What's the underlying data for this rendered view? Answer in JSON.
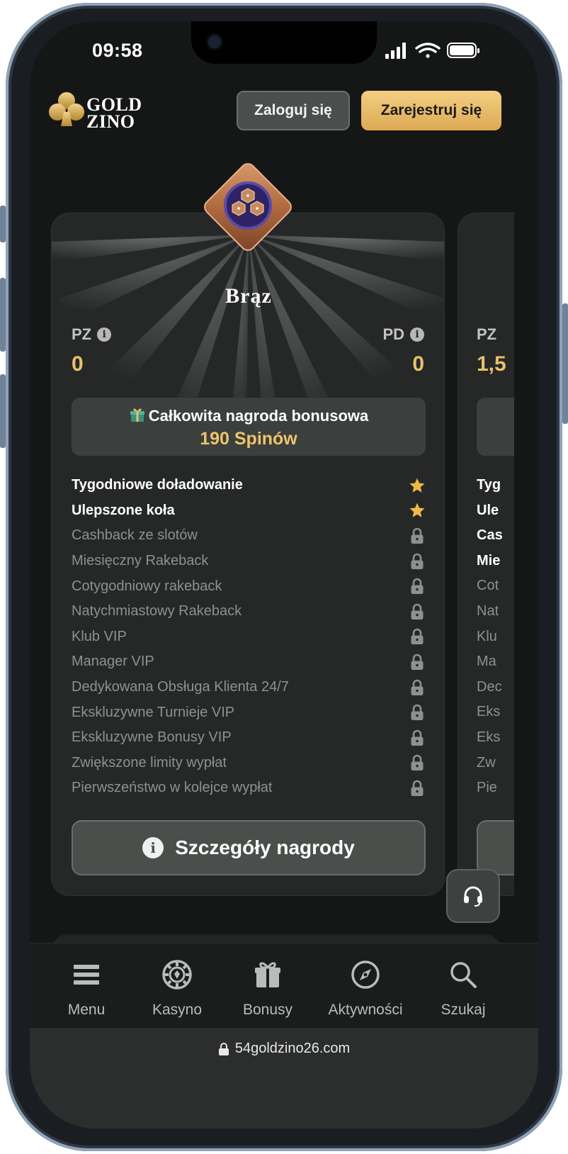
{
  "status_bar": {
    "time": "09:58"
  },
  "header": {
    "logo_line1": "GOLD",
    "logo_line2": "ZINO",
    "login_label": "Zaloguj się",
    "register_label": "Zarejestruj się"
  },
  "colors": {
    "accent_gold": "#e9c06a",
    "card_bg": "#252826",
    "page_bg": "#151716"
  },
  "tier_card": {
    "icon": "bronze-diamond-badge-icon",
    "name": "Brąz",
    "left_stat": {
      "label": "PZ",
      "value": "0"
    },
    "right_stat": {
      "label": "PD",
      "value": "0"
    },
    "bonus_title": "Całkowita nagroda bonusowa",
    "bonus_value": "190 Spinów",
    "perks": [
      {
        "label": "Tygodniowe doładowanie",
        "status": "star"
      },
      {
        "label": "Ulepszone koła",
        "status": "star"
      },
      {
        "label": "Cashback ze slotów",
        "status": "locked"
      },
      {
        "label": "Miesięczny Rakeback",
        "status": "locked"
      },
      {
        "label": "Cotygodniowy rakeback",
        "status": "locked"
      },
      {
        "label": "Natychmiastowy Rakeback",
        "status": "locked"
      },
      {
        "label": "Klub VIP",
        "status": "locked"
      },
      {
        "label": "Manager VIP",
        "status": "locked"
      },
      {
        "label": "Dedykowana Obsługa Klienta 24/7",
        "status": "locked"
      },
      {
        "label": "Ekskluzywne Turnieje VIP",
        "status": "locked"
      },
      {
        "label": "Ekskluzywne Bonusy VIP",
        "status": "locked"
      },
      {
        "label": "Zwiększone limity wypłat",
        "status": "locked"
      },
      {
        "label": "Pierwszeństwo w kolejce wypłat",
        "status": "locked"
      }
    ],
    "details_label": "Szczegóły nagrody"
  },
  "next_card_peek": {
    "stat_label": "PZ",
    "stat_value": "1,5",
    "perks": [
      "Tyg",
      "Ule",
      "Cas",
      "Mie",
      "Cot",
      "Nat",
      "Klu",
      "Ma",
      "Dec",
      "Eks",
      "Eks",
      "Zw",
      "Pie"
    ]
  },
  "bottom_nav": [
    {
      "label": "Menu",
      "icon": "menu-icon"
    },
    {
      "label": "Kasyno",
      "icon": "casino-chip-icon"
    },
    {
      "label": "Bonusy",
      "icon": "gift-icon"
    },
    {
      "label": "Aktywności",
      "icon": "compass-icon"
    },
    {
      "label": "Szukaj",
      "icon": "search-icon"
    }
  ],
  "browser": {
    "url": "54goldzino26.com"
  }
}
